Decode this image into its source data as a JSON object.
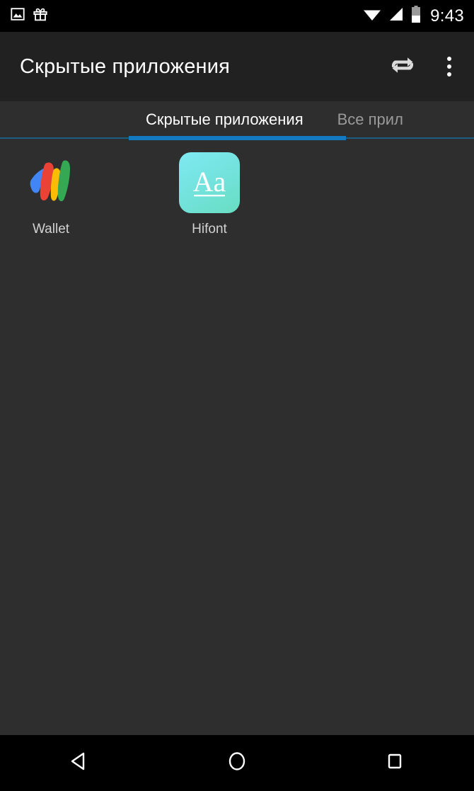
{
  "status_bar": {
    "left_icons": [
      {
        "name": "photo-icon"
      },
      {
        "name": "gift-icon"
      }
    ],
    "right_icons": [
      {
        "name": "wifi-icon"
      },
      {
        "name": "cellular-signal-icon"
      },
      {
        "name": "battery-icon"
      }
    ],
    "clock": "9:43",
    "background": "#000000"
  },
  "app_bar": {
    "title": "Скрытые приложения",
    "background": "#212121",
    "actions": [
      {
        "name": "repeat-icon",
        "label": "Переключить"
      },
      {
        "name": "overflow-menu-icon",
        "label": "Ещё"
      }
    ]
  },
  "tabs": {
    "items": [
      {
        "label": "Скрытые приложения",
        "active": true
      },
      {
        "label": "Все прил",
        "active": false
      }
    ],
    "indicator_color": "#1379c0",
    "underline_color": "#1c5d86",
    "background": "#2e2e2e"
  },
  "content": {
    "background": "#2e2e2e",
    "apps": [
      {
        "label": "Wallet",
        "icon": "google-wallet-icon"
      },
      {
        "label": "Hifont",
        "icon": "hifont-icon",
        "icon_text": "Aa",
        "tile_colors": [
          "#7fe9f2",
          "#68dec1"
        ]
      }
    ]
  },
  "nav_bar": {
    "background": "#000000",
    "buttons": [
      {
        "name": "back-button",
        "label": "Назад"
      },
      {
        "name": "home-button",
        "label": "Главный экран"
      },
      {
        "name": "recents-button",
        "label": "Недавние"
      }
    ]
  }
}
